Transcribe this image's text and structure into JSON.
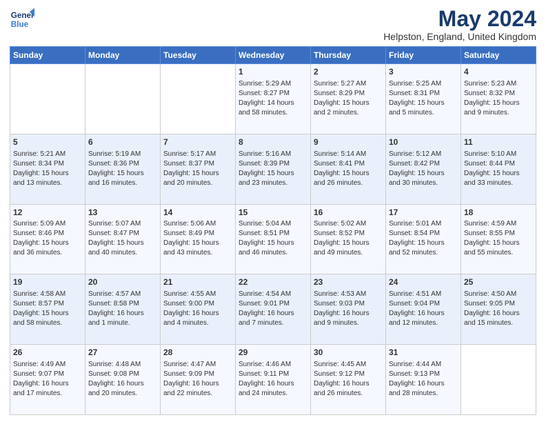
{
  "header": {
    "logo_general": "General",
    "logo_blue": "Blue",
    "title": "May 2024",
    "subtitle": "Helpston, England, United Kingdom"
  },
  "days_of_week": [
    "Sunday",
    "Monday",
    "Tuesday",
    "Wednesday",
    "Thursday",
    "Friday",
    "Saturday"
  ],
  "weeks": [
    [
      {
        "day": "",
        "content": ""
      },
      {
        "day": "",
        "content": ""
      },
      {
        "day": "",
        "content": ""
      },
      {
        "day": "1",
        "content": "Sunrise: 5:29 AM\nSunset: 8:27 PM\nDaylight: 14 hours\nand 58 minutes."
      },
      {
        "day": "2",
        "content": "Sunrise: 5:27 AM\nSunset: 8:29 PM\nDaylight: 15 hours\nand 2 minutes."
      },
      {
        "day": "3",
        "content": "Sunrise: 5:25 AM\nSunset: 8:31 PM\nDaylight: 15 hours\nand 5 minutes."
      },
      {
        "day": "4",
        "content": "Sunrise: 5:23 AM\nSunset: 8:32 PM\nDaylight: 15 hours\nand 9 minutes."
      }
    ],
    [
      {
        "day": "5",
        "content": "Sunrise: 5:21 AM\nSunset: 8:34 PM\nDaylight: 15 hours\nand 13 minutes."
      },
      {
        "day": "6",
        "content": "Sunrise: 5:19 AM\nSunset: 8:36 PM\nDaylight: 15 hours\nand 16 minutes."
      },
      {
        "day": "7",
        "content": "Sunrise: 5:17 AM\nSunset: 8:37 PM\nDaylight: 15 hours\nand 20 minutes."
      },
      {
        "day": "8",
        "content": "Sunrise: 5:16 AM\nSunset: 8:39 PM\nDaylight: 15 hours\nand 23 minutes."
      },
      {
        "day": "9",
        "content": "Sunrise: 5:14 AM\nSunset: 8:41 PM\nDaylight: 15 hours\nand 26 minutes."
      },
      {
        "day": "10",
        "content": "Sunrise: 5:12 AM\nSunset: 8:42 PM\nDaylight: 15 hours\nand 30 minutes."
      },
      {
        "day": "11",
        "content": "Sunrise: 5:10 AM\nSunset: 8:44 PM\nDaylight: 15 hours\nand 33 minutes."
      }
    ],
    [
      {
        "day": "12",
        "content": "Sunrise: 5:09 AM\nSunset: 8:46 PM\nDaylight: 15 hours\nand 36 minutes."
      },
      {
        "day": "13",
        "content": "Sunrise: 5:07 AM\nSunset: 8:47 PM\nDaylight: 15 hours\nand 40 minutes."
      },
      {
        "day": "14",
        "content": "Sunrise: 5:06 AM\nSunset: 8:49 PM\nDaylight: 15 hours\nand 43 minutes."
      },
      {
        "day": "15",
        "content": "Sunrise: 5:04 AM\nSunset: 8:51 PM\nDaylight: 15 hours\nand 46 minutes."
      },
      {
        "day": "16",
        "content": "Sunrise: 5:02 AM\nSunset: 8:52 PM\nDaylight: 15 hours\nand 49 minutes."
      },
      {
        "day": "17",
        "content": "Sunrise: 5:01 AM\nSunset: 8:54 PM\nDaylight: 15 hours\nand 52 minutes."
      },
      {
        "day": "18",
        "content": "Sunrise: 4:59 AM\nSunset: 8:55 PM\nDaylight: 15 hours\nand 55 minutes."
      }
    ],
    [
      {
        "day": "19",
        "content": "Sunrise: 4:58 AM\nSunset: 8:57 PM\nDaylight: 15 hours\nand 58 minutes."
      },
      {
        "day": "20",
        "content": "Sunrise: 4:57 AM\nSunset: 8:58 PM\nDaylight: 16 hours\nand 1 minute."
      },
      {
        "day": "21",
        "content": "Sunrise: 4:55 AM\nSunset: 9:00 PM\nDaylight: 16 hours\nand 4 minutes."
      },
      {
        "day": "22",
        "content": "Sunrise: 4:54 AM\nSunset: 9:01 PM\nDaylight: 16 hours\nand 7 minutes."
      },
      {
        "day": "23",
        "content": "Sunrise: 4:53 AM\nSunset: 9:03 PM\nDaylight: 16 hours\nand 9 minutes."
      },
      {
        "day": "24",
        "content": "Sunrise: 4:51 AM\nSunset: 9:04 PM\nDaylight: 16 hours\nand 12 minutes."
      },
      {
        "day": "25",
        "content": "Sunrise: 4:50 AM\nSunset: 9:05 PM\nDaylight: 16 hours\nand 15 minutes."
      }
    ],
    [
      {
        "day": "26",
        "content": "Sunrise: 4:49 AM\nSunset: 9:07 PM\nDaylight: 16 hours\nand 17 minutes."
      },
      {
        "day": "27",
        "content": "Sunrise: 4:48 AM\nSunset: 9:08 PM\nDaylight: 16 hours\nand 20 minutes."
      },
      {
        "day": "28",
        "content": "Sunrise: 4:47 AM\nSunset: 9:09 PM\nDaylight: 16 hours\nand 22 minutes."
      },
      {
        "day": "29",
        "content": "Sunrise: 4:46 AM\nSunset: 9:11 PM\nDaylight: 16 hours\nand 24 minutes."
      },
      {
        "day": "30",
        "content": "Sunrise: 4:45 AM\nSunset: 9:12 PM\nDaylight: 16 hours\nand 26 minutes."
      },
      {
        "day": "31",
        "content": "Sunrise: 4:44 AM\nSunset: 9:13 PM\nDaylight: 16 hours\nand 28 minutes."
      },
      {
        "day": "",
        "content": ""
      }
    ]
  ]
}
